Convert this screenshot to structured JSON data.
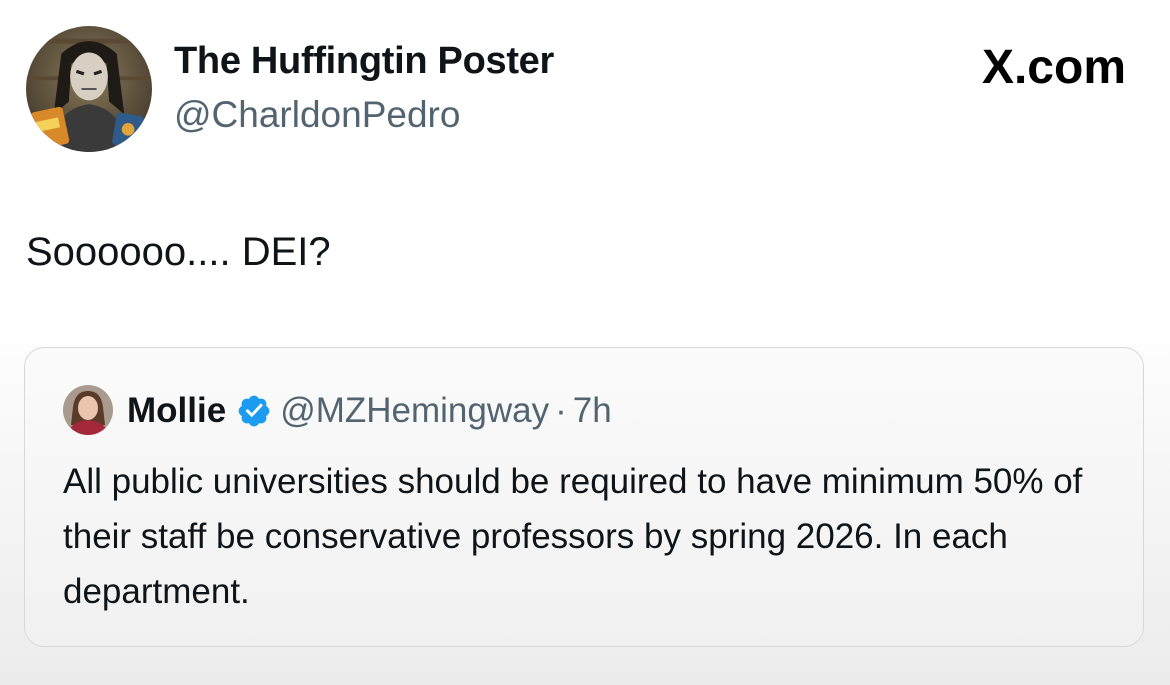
{
  "author": {
    "display_name": "The Huffingtin Poster",
    "handle": "@CharldonPedro",
    "avatar_icon": "profile-avatar-icon"
  },
  "brand": "X.com",
  "tweet": {
    "text": "Soooooo.... DEI?"
  },
  "quoted_tweet": {
    "display_name": "Mollie",
    "verified_icon": "verified-badge-icon",
    "handle": "@MZHemingway",
    "separator": "·",
    "time": "7h",
    "text": "All public universities should be required to have minimum 50% of their staff be conservative professors by spring 2026. In each department."
  },
  "colors": {
    "text": "#0f1419",
    "secondary_text": "#536471",
    "verified_blue": "#1d9bf0",
    "card_border": "#d6d9dc"
  }
}
